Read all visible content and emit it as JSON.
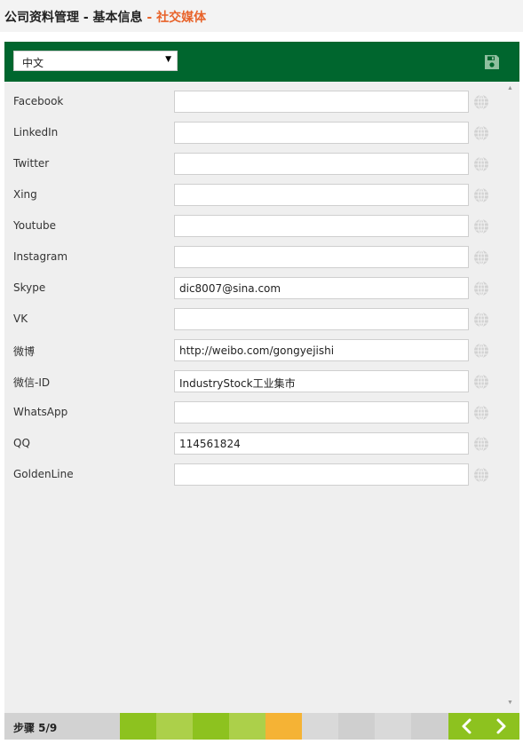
{
  "header": {
    "title_main": "公司资料管理 - 基本信息",
    "title_sep": " - ",
    "title_accent": "社交媒体",
    "accent_color": "#e8632a"
  },
  "toolbar": {
    "language_value": "中文",
    "save_icon": "save-icon",
    "bar_color": "#00662e"
  },
  "fields": [
    {
      "label": "Facebook",
      "value": ""
    },
    {
      "label": "LinkedIn",
      "value": ""
    },
    {
      "label": "Twitter",
      "value": ""
    },
    {
      "label": "Xing",
      "value": ""
    },
    {
      "label": "Youtube",
      "value": ""
    },
    {
      "label": "Instagram",
      "value": ""
    },
    {
      "label": "Skype",
      "value": "dic8007@sina.com"
    },
    {
      "label": "VK",
      "value": ""
    },
    {
      "label": "微博",
      "value": "http://weibo.com/gongyejishi"
    },
    {
      "label": "微信-ID",
      "value": "IndustryStock工业集市"
    },
    {
      "label": "WhatsApp",
      "value": ""
    },
    {
      "label": "QQ",
      "value": "114561824"
    },
    {
      "label": "GoldenLine",
      "value": ""
    }
  ],
  "footer": {
    "step_label": "步骤 5/9",
    "progress_current": 5,
    "progress_total": 9
  }
}
